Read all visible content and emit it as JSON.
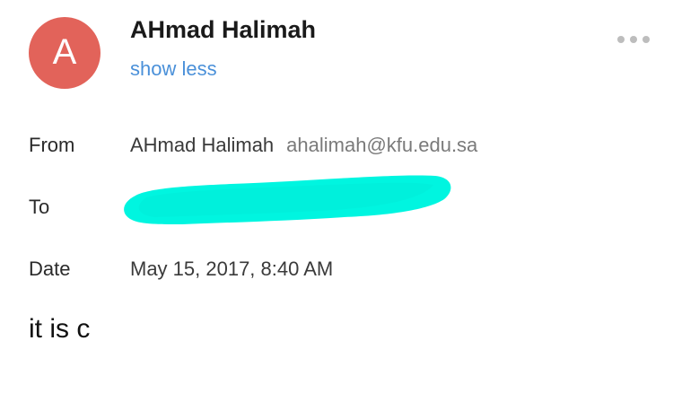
{
  "header": {
    "avatar_letter": "A",
    "avatar_color": "#e2635a",
    "sender_name": "AHmad Halimah",
    "toggle_label": "show less",
    "more_icon": "more-horizontal-icon"
  },
  "details": {
    "from_label": "From",
    "from_name": "AHmad Halimah",
    "from_email": "ahalimah@kfu.edu.sa",
    "to_label": "To",
    "to_redaction_color": "#00f5e0",
    "date_label": "Date",
    "date_value": "May 15, 2017, 8:40 AM"
  },
  "message": {
    "body": "it is c"
  },
  "colors": {
    "link": "#4a90d9",
    "secondary_text": "#7a7a7a"
  }
}
